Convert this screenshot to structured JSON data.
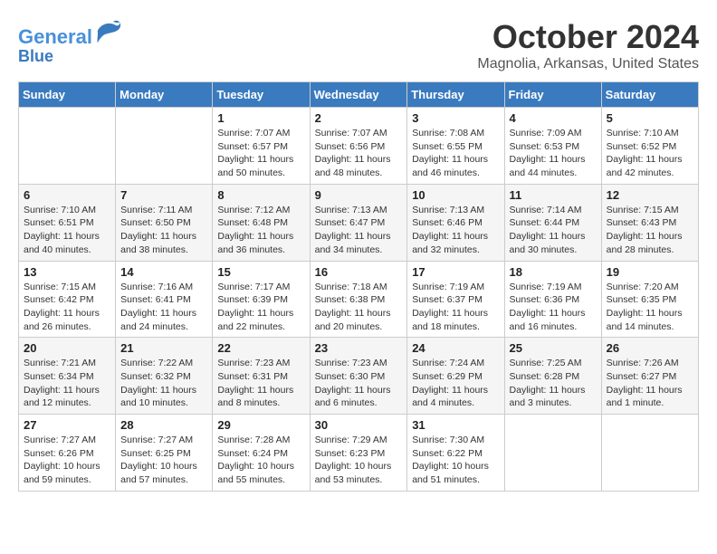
{
  "header": {
    "logo_line1": "General",
    "logo_line2": "Blue",
    "month": "October 2024",
    "location": "Magnolia, Arkansas, United States"
  },
  "days_of_week": [
    "Sunday",
    "Monday",
    "Tuesday",
    "Wednesday",
    "Thursday",
    "Friday",
    "Saturday"
  ],
  "weeks": [
    [
      {
        "day": "",
        "info": ""
      },
      {
        "day": "",
        "info": ""
      },
      {
        "day": "1",
        "info": "Sunrise: 7:07 AM\nSunset: 6:57 PM\nDaylight: 11 hours and 50 minutes."
      },
      {
        "day": "2",
        "info": "Sunrise: 7:07 AM\nSunset: 6:56 PM\nDaylight: 11 hours and 48 minutes."
      },
      {
        "day": "3",
        "info": "Sunrise: 7:08 AM\nSunset: 6:55 PM\nDaylight: 11 hours and 46 minutes."
      },
      {
        "day": "4",
        "info": "Sunrise: 7:09 AM\nSunset: 6:53 PM\nDaylight: 11 hours and 44 minutes."
      },
      {
        "day": "5",
        "info": "Sunrise: 7:10 AM\nSunset: 6:52 PM\nDaylight: 11 hours and 42 minutes."
      }
    ],
    [
      {
        "day": "6",
        "info": "Sunrise: 7:10 AM\nSunset: 6:51 PM\nDaylight: 11 hours and 40 minutes."
      },
      {
        "day": "7",
        "info": "Sunrise: 7:11 AM\nSunset: 6:50 PM\nDaylight: 11 hours and 38 minutes."
      },
      {
        "day": "8",
        "info": "Sunrise: 7:12 AM\nSunset: 6:48 PM\nDaylight: 11 hours and 36 minutes."
      },
      {
        "day": "9",
        "info": "Sunrise: 7:13 AM\nSunset: 6:47 PM\nDaylight: 11 hours and 34 minutes."
      },
      {
        "day": "10",
        "info": "Sunrise: 7:13 AM\nSunset: 6:46 PM\nDaylight: 11 hours and 32 minutes."
      },
      {
        "day": "11",
        "info": "Sunrise: 7:14 AM\nSunset: 6:44 PM\nDaylight: 11 hours and 30 minutes."
      },
      {
        "day": "12",
        "info": "Sunrise: 7:15 AM\nSunset: 6:43 PM\nDaylight: 11 hours and 28 minutes."
      }
    ],
    [
      {
        "day": "13",
        "info": "Sunrise: 7:15 AM\nSunset: 6:42 PM\nDaylight: 11 hours and 26 minutes."
      },
      {
        "day": "14",
        "info": "Sunrise: 7:16 AM\nSunset: 6:41 PM\nDaylight: 11 hours and 24 minutes."
      },
      {
        "day": "15",
        "info": "Sunrise: 7:17 AM\nSunset: 6:39 PM\nDaylight: 11 hours and 22 minutes."
      },
      {
        "day": "16",
        "info": "Sunrise: 7:18 AM\nSunset: 6:38 PM\nDaylight: 11 hours and 20 minutes."
      },
      {
        "day": "17",
        "info": "Sunrise: 7:19 AM\nSunset: 6:37 PM\nDaylight: 11 hours and 18 minutes."
      },
      {
        "day": "18",
        "info": "Sunrise: 7:19 AM\nSunset: 6:36 PM\nDaylight: 11 hours and 16 minutes."
      },
      {
        "day": "19",
        "info": "Sunrise: 7:20 AM\nSunset: 6:35 PM\nDaylight: 11 hours and 14 minutes."
      }
    ],
    [
      {
        "day": "20",
        "info": "Sunrise: 7:21 AM\nSunset: 6:34 PM\nDaylight: 11 hours and 12 minutes."
      },
      {
        "day": "21",
        "info": "Sunrise: 7:22 AM\nSunset: 6:32 PM\nDaylight: 11 hours and 10 minutes."
      },
      {
        "day": "22",
        "info": "Sunrise: 7:23 AM\nSunset: 6:31 PM\nDaylight: 11 hours and 8 minutes."
      },
      {
        "day": "23",
        "info": "Sunrise: 7:23 AM\nSunset: 6:30 PM\nDaylight: 11 hours and 6 minutes."
      },
      {
        "day": "24",
        "info": "Sunrise: 7:24 AM\nSunset: 6:29 PM\nDaylight: 11 hours and 4 minutes."
      },
      {
        "day": "25",
        "info": "Sunrise: 7:25 AM\nSunset: 6:28 PM\nDaylight: 11 hours and 3 minutes."
      },
      {
        "day": "26",
        "info": "Sunrise: 7:26 AM\nSunset: 6:27 PM\nDaylight: 11 hours and 1 minute."
      }
    ],
    [
      {
        "day": "27",
        "info": "Sunrise: 7:27 AM\nSunset: 6:26 PM\nDaylight: 10 hours and 59 minutes."
      },
      {
        "day": "28",
        "info": "Sunrise: 7:27 AM\nSunset: 6:25 PM\nDaylight: 10 hours and 57 minutes."
      },
      {
        "day": "29",
        "info": "Sunrise: 7:28 AM\nSunset: 6:24 PM\nDaylight: 10 hours and 55 minutes."
      },
      {
        "day": "30",
        "info": "Sunrise: 7:29 AM\nSunset: 6:23 PM\nDaylight: 10 hours and 53 minutes."
      },
      {
        "day": "31",
        "info": "Sunrise: 7:30 AM\nSunset: 6:22 PM\nDaylight: 10 hours and 51 minutes."
      },
      {
        "day": "",
        "info": ""
      },
      {
        "day": "",
        "info": ""
      }
    ]
  ]
}
